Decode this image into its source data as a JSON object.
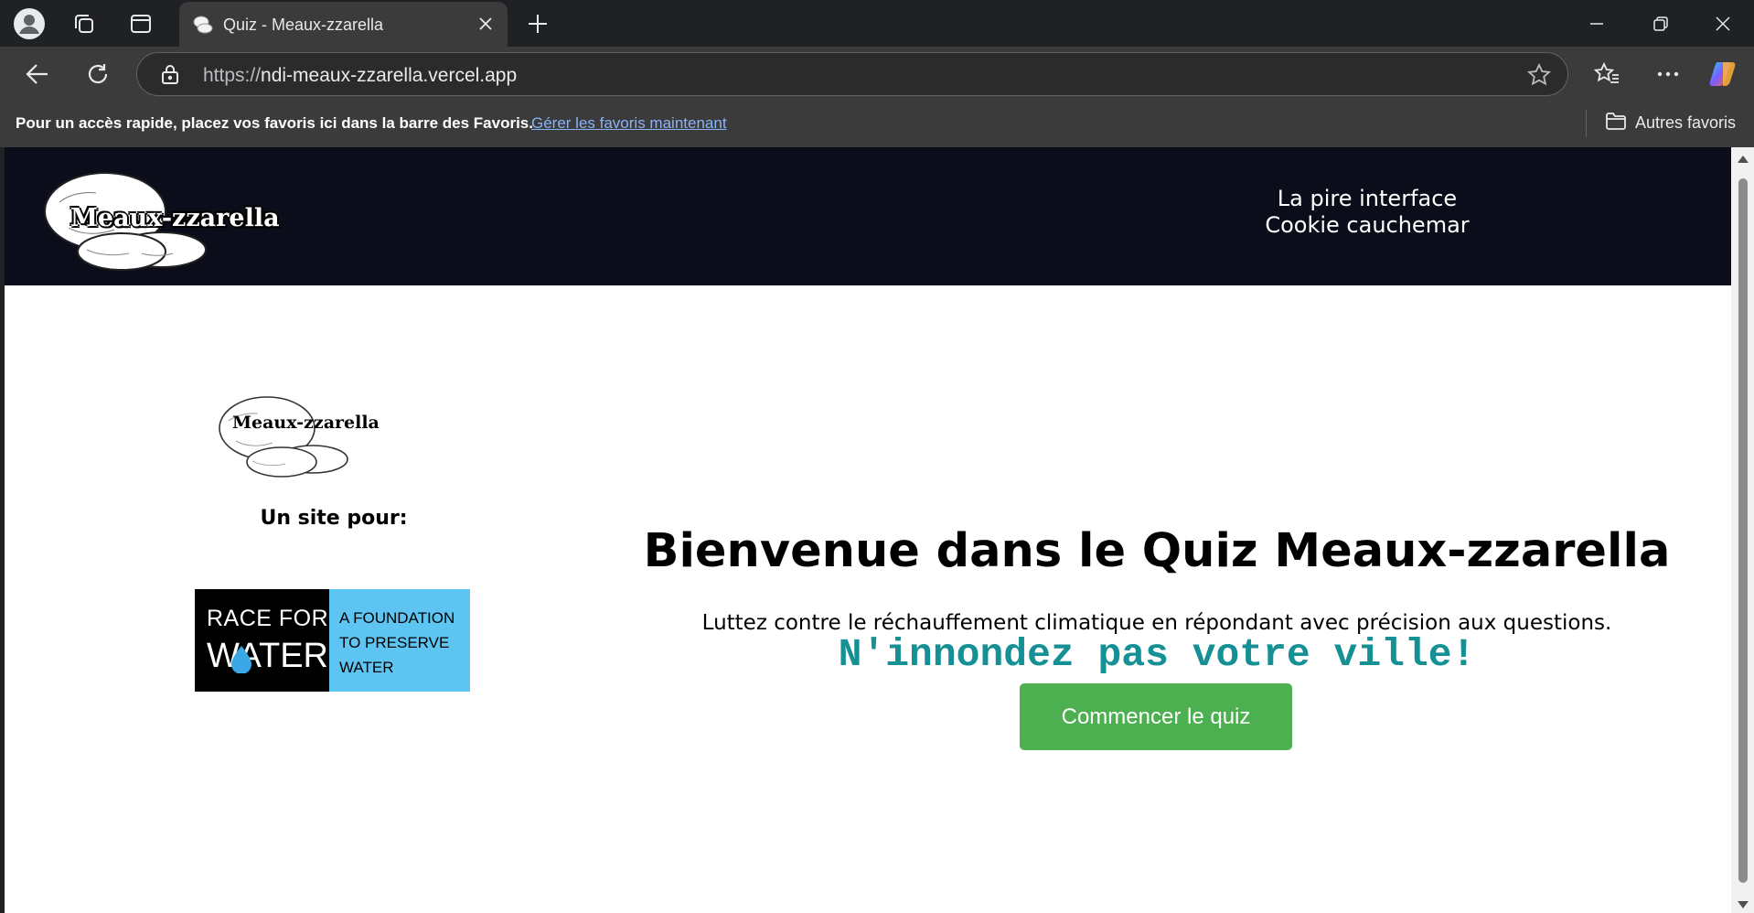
{
  "browser": {
    "tab": {
      "title": "Quiz - Meaux-zzarella"
    },
    "address": {
      "protocol": "https://",
      "host": "ndi-meaux-zzarella.vercel.app"
    },
    "favorites_bar": {
      "prompt": "Pour un accès rapide, placez vos favoris ici dans la barre des Favoris.",
      "manage_link": "Gérer les favoris maintenant",
      "other_favorites": "Autres favoris"
    }
  },
  "site": {
    "brand": "Meaux-zzarella",
    "nav": [
      "La pire interface",
      "Cookie cauchemar"
    ],
    "sidebar": {
      "brand": "Meaux-zzarella",
      "for_label": "Un site pour:",
      "partner": {
        "race_for": "RACE FOR",
        "water": "WATER",
        "tagline_lines": [
          "A FOUNDATION",
          "TO PRESERVE",
          "WATER"
        ],
        "colors": {
          "left_bg": "#000000",
          "right_bg": "#5ec5f2",
          "drop": "#3aa7e6"
        }
      }
    },
    "main": {
      "title": "Bienvenue dans le Quiz Meaux-zzarella",
      "subtitle": "Luttez contre le réchauffement climatique en répondant avec précision aux questions.",
      "warning": "N'innondez pas votre ville!",
      "start_button": "Commencer le quiz"
    },
    "colors": {
      "header_bg": "#0b0e1a",
      "warning": "#159095",
      "button": "#4caf50"
    }
  }
}
